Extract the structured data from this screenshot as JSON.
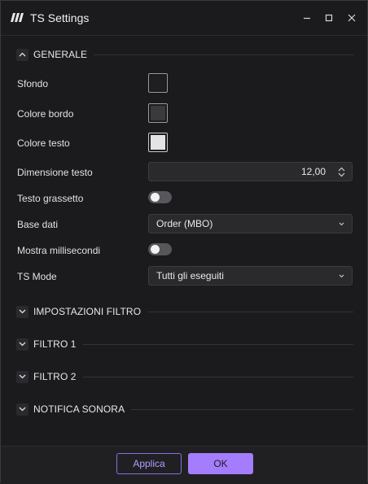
{
  "window": {
    "title": "TS Settings"
  },
  "titlebar": {
    "minimize_icon": "minimize-icon",
    "maximize_icon": "maximize-icon",
    "close_icon": "close-icon"
  },
  "sections": {
    "generale": {
      "title": "GENERALE",
      "expanded": true
    },
    "impostazioni_filtro": {
      "title": "IMPOSTAZIONI FILTRO",
      "expanded": false
    },
    "filtro1": {
      "title": "FILTRO 1",
      "expanded": false
    },
    "filtro2": {
      "title": "FILTRO 2",
      "expanded": false
    },
    "notifica_sonora": {
      "title": "NOTIFICA SONORA",
      "expanded": false
    }
  },
  "general": {
    "sfondo": {
      "label": "Sfondo",
      "color": "#1f1f21"
    },
    "colore_bordo": {
      "label": "Colore bordo",
      "color": "#3a3a3c"
    },
    "colore_testo": {
      "label": "Colore testo",
      "color": "#e3e3e3"
    },
    "dimensione_testo": {
      "label": "Dimensione testo",
      "value": "12,00"
    },
    "testo_grassetto": {
      "label": "Testo grassetto",
      "on": false
    },
    "base_dati": {
      "label": "Base dati",
      "value": "Order (MBO)"
    },
    "mostra_millisecondi": {
      "label": "Mostra millisecondi",
      "on": false
    },
    "ts_mode": {
      "label": "TS Mode",
      "value": "Tutti gli eseguiti"
    }
  },
  "footer": {
    "apply_label": "Applica",
    "ok_label": "OK"
  },
  "colors": {
    "accent": "#a47dff",
    "accent_border": "#8a6ee6",
    "background": "#1b1b1d"
  }
}
